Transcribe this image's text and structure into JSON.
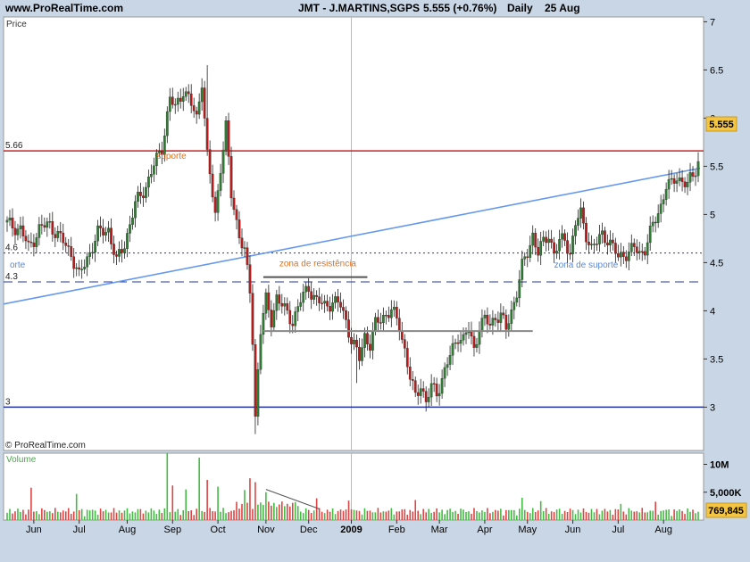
{
  "header": {
    "site": "www.ProRealTime.com",
    "symbol": "JMT - J.MARTINS,SGPS",
    "change": "5.555 (+0.76%)",
    "period": "Daily",
    "date": "25 Aug"
  },
  "colors": {
    "background": "#c9d6e6",
    "panel": "#ffffff",
    "up_candle": "#2e7d32",
    "down_candle": "#b71c1c",
    "trendline": "#6699ee",
    "resistance_line": "#cc2222",
    "support_line": "#2233aa",
    "annotation_orange": "#e0701c",
    "annotation_blue": "#5588dd",
    "volume_up": "#44bb44",
    "volume_down": "#dd4444"
  },
  "chart_data": {
    "type": "candlestick",
    "price_panel": {
      "label": "Price",
      "y_ticks": [
        3,
        3.5,
        4,
        4.5,
        5,
        5.5,
        6,
        6.5,
        7
      ],
      "ylim": [
        2.55,
        7.05
      ],
      "current_value": "5.555",
      "close_path": [
        [
          0,
          4.9
        ],
        [
          5,
          4.85
        ],
        [
          8,
          4.65
        ],
        [
          12,
          4.85
        ],
        [
          16,
          4.9
        ],
        [
          20,
          4.75
        ],
        [
          24,
          4.6
        ],
        [
          27,
          4.35
        ],
        [
          30,
          4.55
        ],
        [
          34,
          4.8
        ],
        [
          38,
          4.85
        ],
        [
          41,
          4.5
        ],
        [
          44,
          4.7
        ],
        [
          48,
          5.1
        ],
        [
          52,
          5.3
        ],
        [
          55,
          5.5
        ],
        [
          58,
          5.7
        ],
        [
          61,
          6.2
        ],
        [
          63,
          6.1
        ],
        [
          66,
          6.3
        ],
        [
          68,
          6.2
        ],
        [
          71,
          6.0
        ],
        [
          73,
          6.4
        ],
        [
          75,
          5.6
        ],
        [
          78,
          5.0
        ],
        [
          80,
          5.5
        ],
        [
          82,
          5.9
        ],
        [
          84,
          5.2
        ],
        [
          87,
          4.8
        ],
        [
          89,
          4.6
        ],
        [
          91,
          4.2
        ],
        [
          92,
          3.7
        ],
        [
          93,
          2.9
        ],
        [
          94,
          3.4
        ],
        [
          95,
          3.8
        ],
        [
          97,
          4.1
        ],
        [
          99,
          3.9
        ],
        [
          101,
          4.15
        ],
        [
          104,
          4.0
        ],
        [
          107,
          3.9
        ],
        [
          110,
          4.1
        ],
        [
          113,
          4.25
        ],
        [
          116,
          4.1
        ],
        [
          119,
          4.05
        ],
        [
          122,
          4.1
        ],
        [
          125,
          4.05
        ],
        [
          127,
          3.9
        ],
        [
          129,
          3.7
        ],
        [
          132,
          3.5
        ],
        [
          134,
          3.75
        ],
        [
          136,
          3.65
        ],
        [
          138,
          3.85
        ],
        [
          141,
          3.95
        ],
        [
          144,
          4.0
        ],
        [
          147,
          3.85
        ],
        [
          149,
          3.6
        ],
        [
          151,
          3.3
        ],
        [
          153,
          3.1
        ],
        [
          155,
          3.25
        ],
        [
          157,
          3.05
        ],
        [
          159,
          3.2
        ],
        [
          161,
          3.15
        ],
        [
          163,
          3.3
        ],
        [
          165,
          3.45
        ],
        [
          167,
          3.6
        ],
        [
          169,
          3.75
        ],
        [
          171,
          3.7
        ],
        [
          173,
          3.8
        ],
        [
          175,
          3.6
        ],
        [
          177,
          3.85
        ],
        [
          179,
          3.9
        ],
        [
          181,
          3.85
        ],
        [
          183,
          3.95
        ],
        [
          185,
          3.95
        ],
        [
          187,
          3.8
        ],
        [
          189,
          4.0
        ],
        [
          191,
          4.2
        ],
        [
          193,
          4.45
        ],
        [
          195,
          4.6
        ],
        [
          197,
          4.8
        ],
        [
          199,
          4.6
        ],
        [
          201,
          4.7
        ],
        [
          203,
          4.8
        ],
        [
          205,
          4.6
        ],
        [
          207,
          4.7
        ],
        [
          209,
          4.75
        ],
        [
          211,
          4.6
        ],
        [
          213,
          4.9
        ],
        [
          215,
          5.0
        ],
        [
          217,
          4.8
        ],
        [
          219,
          4.65
        ],
        [
          221,
          4.7
        ],
        [
          223,
          4.8
        ],
        [
          225,
          4.75
        ],
        [
          227,
          4.65
        ],
        [
          229,
          4.55
        ],
        [
          231,
          4.6
        ],
        [
          233,
          4.6
        ],
        [
          235,
          4.65
        ],
        [
          237,
          4.6
        ],
        [
          239,
          4.65
        ],
        [
          241,
          4.8
        ],
        [
          243,
          4.95
        ],
        [
          245,
          5.1
        ],
        [
          247,
          5.3
        ],
        [
          249,
          5.3
        ],
        [
          251,
          5.4
        ],
        [
          253,
          5.35
        ],
        [
          255,
          5.3
        ],
        [
          257,
          5.4
        ],
        [
          259,
          5.55
        ]
      ],
      "events": [
        {
          "index": 75,
          "high": 6.55,
          "low": 6.0
        },
        {
          "index": 93,
          "high": 3.7,
          "low": 2.72
        },
        {
          "index": 131,
          "high": 3.5,
          "low": 3.25
        }
      ],
      "horizontal_lines": [
        {
          "value": 5.66,
          "label": "5.66",
          "style": "solid",
          "color": "resistance_line"
        },
        {
          "value": 4.6,
          "label": "4.6",
          "style": "dotted",
          "color": "support_line"
        },
        {
          "value": 4.3,
          "label": "4.3",
          "style": "dashed",
          "color": "support_line"
        },
        {
          "value": 3.0,
          "label": "3",
          "style": "solid",
          "color": "support_line"
        }
      ],
      "trendline": {
        "x0": 0,
        "y0": 4.07,
        "x1": 259,
        "y1": 5.48
      },
      "zone_lines": [
        {
          "x0": 96,
          "x1": 135,
          "value": 4.35,
          "color": "#555555"
        },
        {
          "x0": 96,
          "x1": 197,
          "value": 3.79,
          "color": "#888888"
        }
      ],
      "annotations": [
        {
          "text": "suporte",
          "x": 56,
          "value": 5.58,
          "color": "annotation_orange"
        },
        {
          "text": "zona de resistência",
          "x": 102,
          "value": 4.46,
          "color": "annotation_orange"
        },
        {
          "text": "orte",
          "x": 1,
          "value": 4.45,
          "color": "annotation_blue"
        },
        {
          "text": "zona de suporte",
          "x": 205,
          "value": 4.45,
          "color": "annotation_blue"
        }
      ]
    },
    "volume_panel": {
      "label": "Volume",
      "y_ticks": [
        {
          "value": 10000000,
          "label": "10M"
        },
        {
          "value": 5000000,
          "label": "5,000K"
        }
      ],
      "ylim": [
        0,
        12000000
      ],
      "current_value": "769,845",
      "spikes": [
        {
          "index": 9,
          "value": 5800000
        },
        {
          "index": 26,
          "value": 4700000
        },
        {
          "index": 60,
          "value": 12000000
        },
        {
          "index": 62,
          "value": 6200000
        },
        {
          "index": 67,
          "value": 5500000
        },
        {
          "index": 72,
          "value": 11200000
        },
        {
          "index": 75,
          "value": 7200000
        },
        {
          "index": 79,
          "value": 6000000
        },
        {
          "index": 89,
          "value": 5400000
        },
        {
          "index": 91,
          "value": 7500000
        },
        {
          "index": 93,
          "value": 6800000
        },
        {
          "index": 97,
          "value": 5000000
        },
        {
          "index": 116,
          "value": 3900000
        },
        {
          "index": 128,
          "value": 3500000
        },
        {
          "index": 153,
          "value": 3600000
        },
        {
          "index": 193,
          "value": 4000000
        },
        {
          "index": 200,
          "value": 3400000
        },
        {
          "index": 230,
          "value": 2900000
        },
        {
          "index": 243,
          "value": 3300000
        }
      ],
      "trendline": {
        "x0": 97,
        "y0": 5500000,
        "x1": 117,
        "y1": 2000000
      }
    },
    "x_axis": {
      "total_bars": 260,
      "labels": [
        {
          "text": "Jun",
          "x": 10
        },
        {
          "text": "Jul",
          "x": 27
        },
        {
          "text": "Aug",
          "x": 45
        },
        {
          "text": "Sep",
          "x": 62
        },
        {
          "text": "Oct",
          "x": 79
        },
        {
          "text": "Nov",
          "x": 97
        },
        {
          "text": "Dec",
          "x": 113
        },
        {
          "text": "2009",
          "x": 129,
          "bold": true
        },
        {
          "text": "Feb",
          "x": 146
        },
        {
          "text": "Mar",
          "x": 162
        },
        {
          "text": "Apr",
          "x": 179
        },
        {
          "text": "May",
          "x": 195
        },
        {
          "text": "Jun",
          "x": 212
        },
        {
          "text": "Jul",
          "x": 229
        },
        {
          "text": "Aug",
          "x": 246
        }
      ],
      "separator_x": 129
    }
  },
  "watermark": "© ProRealTime.com"
}
